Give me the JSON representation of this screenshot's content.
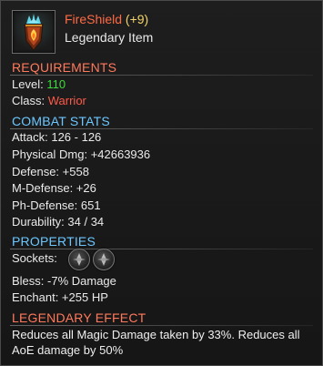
{
  "item": {
    "name": "FireShield",
    "plus": "(+9)",
    "rarity": "Legendary Item",
    "name_color": "#ff6a45",
    "icon": "fire-shield-icon"
  },
  "requirements": {
    "title": "REQUIREMENTS",
    "title_color": "#ff7a5c",
    "level_label": "Level:",
    "level_value": "110",
    "class_label": "Class:",
    "class_value": "Warrior"
  },
  "combat": {
    "title": "COMBAT STATS",
    "title_color": "#6cc7ff",
    "rows": [
      "Attack: 126 - 126",
      "Physical Dmg: +42663936",
      "Defense: +558",
      "M-Defense: +26",
      "Ph-Defense: 651",
      "Durability: 34 / 34"
    ]
  },
  "properties": {
    "title": "PROPERTIES",
    "title_color": "#6cc7ff",
    "sockets_label": "Sockets:",
    "bless": "Bless: -7% Damage",
    "enchant": "Enchant: +255 HP"
  },
  "legendary": {
    "title": "LEGENDARY EFFECT",
    "title_color": "#ff7a5c",
    "text": "Reduces all Magic Damage taken by 33%. Reduces all AoE damage by 50%"
  }
}
